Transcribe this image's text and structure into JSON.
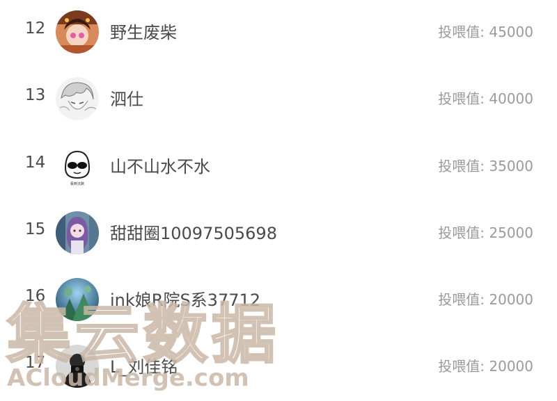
{
  "feed_label": "投喂值: ",
  "rows": [
    {
      "rank": "12",
      "name": "野生废柴",
      "feed": "投喂值: 45000",
      "avatar": "anime-girl-avatar"
    },
    {
      "rank": "13",
      "name": "泗仕",
      "feed": "投喂值: 40000",
      "avatar": "sketch-character-avatar"
    },
    {
      "rank": "14",
      "name": "山不山水不水",
      "feed": "投喂值: 35000",
      "avatar": "sunglasses-meme-avatar"
    },
    {
      "rank": "15",
      "name": "甜甜圈10097505698",
      "feed": "投喂值: 25000",
      "avatar": "purple-hair-anime-avatar"
    },
    {
      "rank": "16",
      "name": "ink娘R院S系37712",
      "feed": "投喂值: 20000",
      "avatar": "forest-avatar"
    },
    {
      "rank": "17",
      "name": "L_刘佳铭",
      "feed": "投喂值: 20000",
      "avatar": "photographer-avatar"
    }
  ],
  "avatar_meme_caption": "看到沉默",
  "watermark": {
    "cn": "集云数据",
    "en": "ACloudMerge.com"
  },
  "colors": {
    "text": "#4a4a4a",
    "muted": "#9a9a9a",
    "watermark": "#c9b8a6"
  }
}
